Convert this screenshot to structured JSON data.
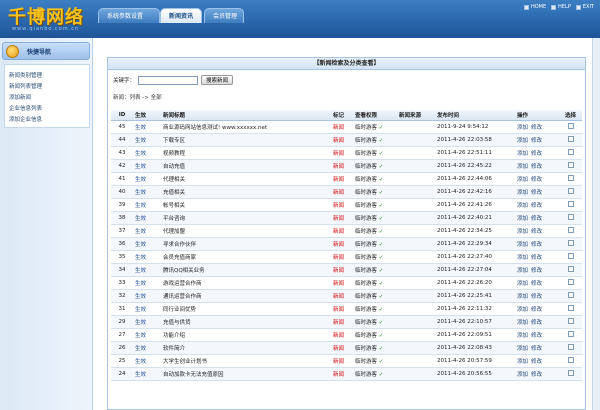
{
  "app": {
    "logo": "千博网络",
    "logo_sub": "www.qianbo.com.cn"
  },
  "nav": {
    "tabs": [
      "系统参数设置",
      "新闻资讯",
      "会员管理"
    ],
    "active_tab": 1
  },
  "toplinks": [
    "HOME",
    "HELP",
    "EXIT"
  ],
  "sidebar": {
    "title": "快捷导航",
    "items": [
      "新闻类别管理",
      "新闻列表管理",
      "添加新闻",
      "企业信息列表",
      "添加企业信息"
    ]
  },
  "panel": {
    "title": "【新闻检索及分类查看】",
    "search_label": "关键字：",
    "search_value": "",
    "search_button": "搜索新闻",
    "breadcrumb": "新闻：列表 -> 全部"
  },
  "table": {
    "headers": [
      "ID",
      "生效",
      "新闻标题",
      "标记",
      "查看权限",
      "新闻来源",
      "发布时间",
      "操作",
      "选择"
    ],
    "rows": [
      {
        "id": "45",
        "pub": "生效",
        "title": "商业源码网站信息测试! www.xxxxxx.net",
        "tag": "新闻",
        "perm": "临时游客",
        "check": "✓",
        "src": "",
        "time": "2011-9-24 9:54:12"
      },
      {
        "id": "44",
        "pub": "生效",
        "title": "下载专区",
        "tag": "新闻",
        "perm": "临时游客",
        "check": "✓",
        "src": "",
        "time": "2011-4-26 22:03:58"
      },
      {
        "id": "43",
        "pub": "生效",
        "title": "视频教程",
        "tag": "新闻",
        "perm": "临时游客",
        "check": "✓",
        "src": "",
        "time": "2011-4-26 22:51:11"
      },
      {
        "id": "42",
        "pub": "生效",
        "title": "自动充值",
        "tag": "新闻",
        "perm": "临时游客",
        "check": "✓",
        "src": "",
        "time": "2011-4-26 22:45:22"
      },
      {
        "id": "41",
        "pub": "生效",
        "title": "代理相关",
        "tag": "新闻",
        "perm": "临时游客",
        "check": "✓",
        "src": "",
        "time": "2011-4-26 22:44:06"
      },
      {
        "id": "40",
        "pub": "生效",
        "title": "充值相关",
        "tag": "新闻",
        "perm": "临时游客",
        "check": "✓",
        "src": "",
        "time": "2011-4-26 22:42:16"
      },
      {
        "id": "39",
        "pub": "生效",
        "title": "帐号相关",
        "tag": "新闻",
        "perm": "临时游客",
        "check": "✓",
        "src": "",
        "time": "2011-4-26 22:41:26"
      },
      {
        "id": "38",
        "pub": "生效",
        "title": "平台咨询",
        "tag": "新闻",
        "perm": "临时游客",
        "check": "✓",
        "src": "",
        "time": "2011-4-26 22:40:21"
      },
      {
        "id": "37",
        "pub": "生效",
        "title": "代理加盟",
        "tag": "新闻",
        "perm": "临时游客",
        "check": "✓",
        "src": "",
        "time": "2011-4-26 22:34:25"
      },
      {
        "id": "36",
        "pub": "生效",
        "title": "寻求合作伙伴",
        "tag": "新闻",
        "perm": "临时游客",
        "check": "✓",
        "src": "",
        "time": "2011-4-26 22:29:34"
      },
      {
        "id": "35",
        "pub": "生效",
        "title": "会员充值商家",
        "tag": "新闻",
        "perm": "临时游客",
        "check": "✓",
        "src": "",
        "time": "2011-4-26 22:27:40"
      },
      {
        "id": "34",
        "pub": "生效",
        "title": "腾讯QQ相关业务",
        "tag": "新闻",
        "perm": "临时游客",
        "check": "✓",
        "src": "",
        "time": "2011-4-26 22:27:04"
      },
      {
        "id": "33",
        "pub": "生效",
        "title": "游戏运营合作商",
        "tag": "新闻",
        "perm": "临时游客",
        "check": "✓",
        "src": "",
        "time": "2011-4-26 22:26:20"
      },
      {
        "id": "32",
        "pub": "生效",
        "title": "通讯运营合作商",
        "tag": "新闻",
        "perm": "临时游客",
        "check": "✓",
        "src": "",
        "time": "2011-4-26 22:25:41"
      },
      {
        "id": "31",
        "pub": "生效",
        "title": "同行业间优势",
        "tag": "新闻",
        "perm": "临时游客",
        "check": "✓",
        "src": "",
        "time": "2011-4-26 22:11:32"
      },
      {
        "id": "29",
        "pub": "生效",
        "title": "充值与供货",
        "tag": "新闻",
        "perm": "临时游客",
        "check": "✓",
        "src": "",
        "time": "2011-4-26 22:10:57"
      },
      {
        "id": "27",
        "pub": "生效",
        "title": "功能介绍",
        "tag": "新闻",
        "perm": "临时游客",
        "check": "✓",
        "src": "",
        "time": "2011-4-26 22:09:51"
      },
      {
        "id": "26",
        "pub": "生效",
        "title": "软件简介",
        "tag": "新闻",
        "perm": "临时游客",
        "check": "✓",
        "src": "",
        "time": "2011-4-26 22:08:43"
      },
      {
        "id": "25",
        "pub": "生效",
        "title": "大学生创业计划书",
        "tag": "新闻",
        "perm": "临时游客",
        "check": "✓",
        "src": "",
        "time": "2011-4-26 20:57:59"
      },
      {
        "id": "24",
        "pub": "生效",
        "title": "自动加款卡无法充值原因",
        "tag": "新闻",
        "perm": "临时游客",
        "check": "✓",
        "src": "",
        "time": "2011-4-26 20:56:55"
      }
    ],
    "op_add": "添加",
    "op_edit": "修改"
  }
}
